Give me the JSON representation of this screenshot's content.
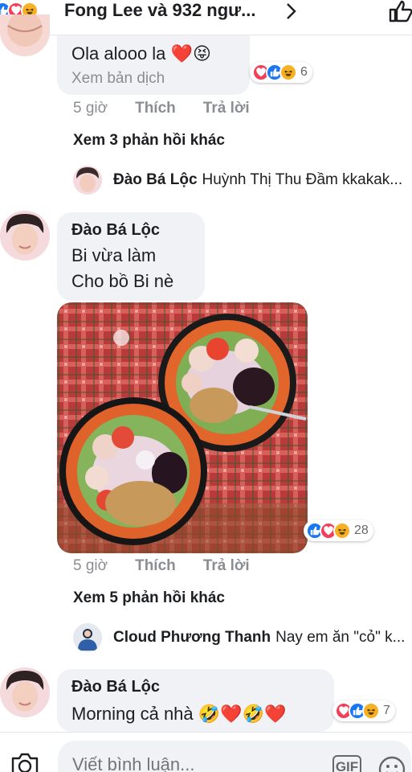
{
  "header": {
    "title": "Fong Lee và 932 ngư...",
    "reactions": [
      "like",
      "love",
      "haha"
    ]
  },
  "comments": [
    {
      "text": "Ola alooo la",
      "emoji": "❤️😝",
      "translate": "Xem bản dịch",
      "reaction_count": "6",
      "time": "5 giờ",
      "like_label": "Thích",
      "reply_label": "Trả lời",
      "more_replies": "Xem 3 phản hồi khác",
      "preview_reply": {
        "name": "Đào Bá Lộc",
        "text": "Huỳnh Thị Thu Đầm kkakak..."
      }
    },
    {
      "name": "Đào Bá Lộc",
      "line1": "Bi vừa làm",
      "line2": "Cho bồ Bi nè",
      "reaction_count": "28",
      "time": "5 giờ",
      "like_label": "Thích",
      "reply_label": "Trả lời",
      "more_replies": "Xem 5 phản hồi khác",
      "preview_reply": {
        "name": "Cloud Phương Thanh",
        "text": "Nay em ăn \"cỏ\" k..."
      }
    },
    {
      "name": "Đào Bá Lộc",
      "text": "Morning cả nhà",
      "emoji": "🤣❤️🤣❤️",
      "reaction_count": "7"
    }
  ],
  "composer": {
    "placeholder": "Viết bình luận...",
    "gif_label": "GIF"
  },
  "colors": {
    "like": "#1877f2",
    "love": "#f33e58",
    "haha": "#f7b125",
    "bubble": "#f0f2f5",
    "muted": "#8a8d91"
  }
}
